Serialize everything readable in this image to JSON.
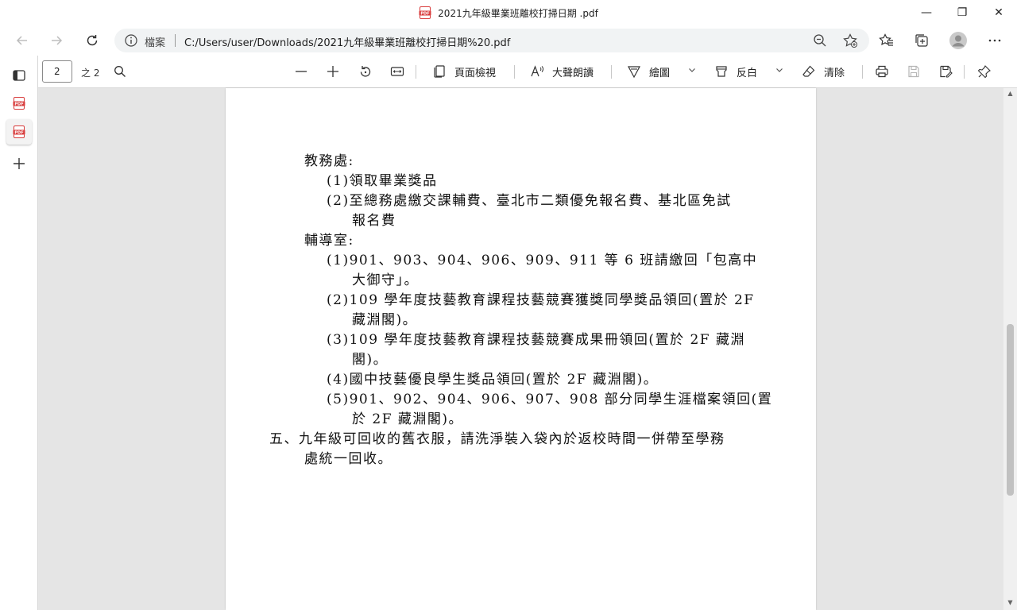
{
  "window": {
    "title": "2021九年級畢業班離校打掃日期 .pdf",
    "controls": {
      "minimize": "—",
      "restore": "❐",
      "close": "✕"
    }
  },
  "address_bar": {
    "info_label": "檔案",
    "url": "C:/Users/user/Downloads/2021九年級畢業班離校打掃日期%20.pdf"
  },
  "pdf_toolbar": {
    "page_number": "2",
    "of_pages": "之 2",
    "page_view": "頁面檢視",
    "read_aloud": "大聲朗讀",
    "draw": "繪圖",
    "highlight": "反白",
    "erase": "清除"
  },
  "document": {
    "lines": [
      "教務處:",
      "(1)領取畢業獎品",
      "(2)至總務處繳交課輔費、臺北市二類優免報名費、基北區免試",
      "報名費",
      "輔導室:",
      "(1)901、903、904、906、909、911 等 6 班請繳回「包高中",
      "大御守」。",
      "(2)109 學年度技藝教育課程技藝競賽獲獎同學獎品領回(置於 2F",
      "藏淵閣)。",
      "(3)109 學年度技藝教育課程技藝競賽成果冊領回(置於 2F 藏淵",
      "閣)。",
      "(4)國中技藝優良學生獎品領回(置於 2F 藏淵閣)。",
      "(5)901、902、904、906、907、908 部分同學生涯檔案領回(置",
      "於 2F 藏淵閣)。",
      "五、九年級可回收的舊衣服，請洗淨裝入袋內於返校時間一併帶至學務",
      "處統一回收。"
    ]
  },
  "colors": {
    "pdf_red": "#d83b3b",
    "viewer_bg": "#e5e5e5"
  }
}
